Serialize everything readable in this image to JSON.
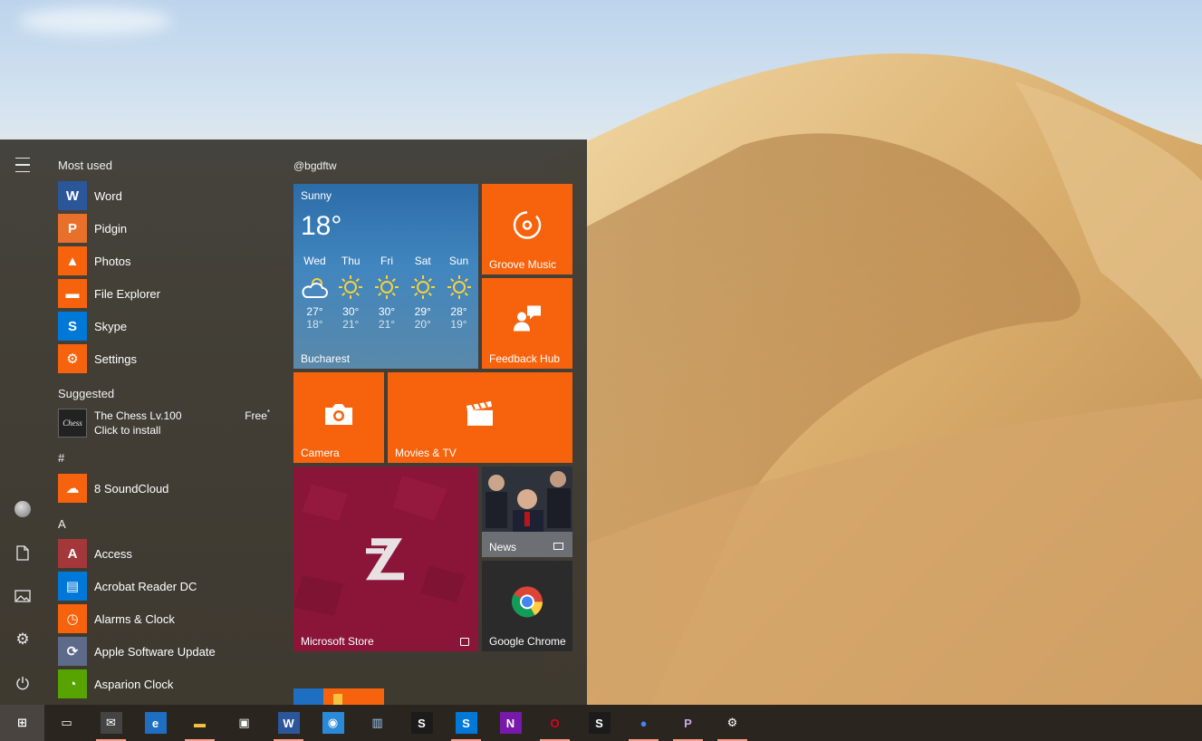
{
  "start_menu": {
    "most_used_heading": "Most used",
    "most_used": [
      {
        "label": "Word",
        "icon": "word-icon",
        "color": "#2b579a",
        "glyph": "W"
      },
      {
        "label": "Pidgin",
        "icon": "pidgin-icon",
        "color": "#e8702a",
        "glyph": "P"
      },
      {
        "label": "Photos",
        "icon": "photos-icon",
        "color": "#f7630c",
        "glyph": "▲"
      },
      {
        "label": "File Explorer",
        "icon": "file-explorer-icon",
        "color": "#f7630c",
        "glyph": "▬"
      },
      {
        "label": "Skype",
        "icon": "skype-icon",
        "color": "#0078d7",
        "glyph": "S"
      },
      {
        "label": "Settings",
        "icon": "gear-icon",
        "color": "#f7630c",
        "glyph": "⚙"
      }
    ],
    "suggested_heading": "Suggested",
    "suggested": {
      "name": "The Chess Lv.100",
      "action": "Click to install",
      "price": "Free",
      "icon_text": "Chess"
    },
    "hash_heading": "#",
    "hash_apps": [
      {
        "label": "8 SoundCloud",
        "icon": "soundcloud-icon",
        "color": "#f7630c",
        "glyph": "☁"
      }
    ],
    "a_heading": "A",
    "a_apps": [
      {
        "label": "Access",
        "icon": "access-icon",
        "color": "#a4373a",
        "glyph": "A"
      },
      {
        "label": "Acrobat Reader DC",
        "icon": "acrobat-icon",
        "color": "#0078d7",
        "glyph": "▤"
      },
      {
        "label": "Alarms & Clock",
        "icon": "alarm-clock-icon",
        "color": "#f7630c",
        "glyph": "◷"
      },
      {
        "label": "Apple Software Update",
        "icon": "apple-update-icon",
        "color": "#5e6a8a",
        "glyph": "⟳"
      },
      {
        "label": "Asparion Clock",
        "icon": "clock-icon",
        "color": "#57a300",
        "glyph": "◔"
      }
    ]
  },
  "tiles": {
    "group_title": "@bgdftw",
    "weather": {
      "condition": "Sunny",
      "temperature": "18°",
      "city": "Bucharest",
      "forecast": [
        {
          "day": "Wed",
          "hi": "27°",
          "lo": "18°",
          "icon": "partly-cloudy-icon"
        },
        {
          "day": "Thu",
          "hi": "30°",
          "lo": "21°",
          "icon": "sun-icon"
        },
        {
          "day": "Fri",
          "hi": "30°",
          "lo": "21°",
          "icon": "sun-icon"
        },
        {
          "day": "Sat",
          "hi": "29°",
          "lo": "20°",
          "icon": "sun-icon"
        },
        {
          "day": "Sun",
          "hi": "28°",
          "lo": "19°",
          "icon": "sun-icon"
        }
      ]
    },
    "groove_music": "Groove Music",
    "feedback_hub": "Feedback Hub",
    "camera": "Camera",
    "movies_tv": "Movies & TV",
    "microsoft_store": "Microsoft Store",
    "news": "News",
    "google_chrome": "Google Chrome",
    "accent": "#f7630c"
  },
  "taskbar": {
    "items": [
      {
        "name": "start-button",
        "glyph": "⊞",
        "color": "#ffffff",
        "bg": "transparent",
        "active": true,
        "running": false
      },
      {
        "name": "task-view-button",
        "glyph": "▭",
        "color": "#ffffff",
        "bg": "transparent",
        "active": false,
        "running": false
      },
      {
        "name": "mail-taskbar-icon",
        "glyph": "✉",
        "color": "#ffffff",
        "bg": "#444444",
        "active": false,
        "running": true
      },
      {
        "name": "edge-taskbar-icon",
        "glyph": "e",
        "color": "#ffffff",
        "bg": "#1e6fc2",
        "active": false,
        "running": false
      },
      {
        "name": "file-explorer-taskbar-icon",
        "glyph": "▬",
        "color": "#f5c242",
        "bg": "transparent",
        "active": false,
        "running": true
      },
      {
        "name": "store-taskbar-icon",
        "glyph": "▣",
        "color": "#ffffff",
        "bg": "transparent",
        "active": false,
        "running": false
      },
      {
        "name": "word-taskbar-icon",
        "glyph": "W",
        "color": "#ffffff",
        "bg": "#2b579a",
        "active": false,
        "running": true
      },
      {
        "name": "keepass-taskbar-icon",
        "glyph": "◉",
        "color": "#ffffff",
        "bg": "#2a8ad8",
        "active": false,
        "running": false
      },
      {
        "name": "remote-desktop-taskbar-icon",
        "glyph": "▥",
        "color": "#9ecbf0",
        "bg": "transparent",
        "active": false,
        "running": false
      },
      {
        "name": "app-s-taskbar-icon",
        "glyph": "S",
        "color": "#ffffff",
        "bg": "#1b1b1b",
        "active": false,
        "running": false
      },
      {
        "name": "skype-taskbar-icon",
        "glyph": "S",
        "color": "#ffffff",
        "bg": "#0078d7",
        "active": false,
        "running": true
      },
      {
        "name": "onenote-taskbar-icon",
        "glyph": "N",
        "color": "#ffffff",
        "bg": "#7719aa",
        "active": false,
        "running": false
      },
      {
        "name": "opera-taskbar-icon",
        "glyph": "O",
        "color": "#e3001b",
        "bg": "transparent",
        "active": false,
        "running": true
      },
      {
        "name": "app-s2-taskbar-icon",
        "glyph": "S",
        "color": "#ffffff",
        "bg": "#1b1b1b",
        "active": false,
        "running": false
      },
      {
        "name": "chrome-taskbar-icon",
        "glyph": "●",
        "color": "#4285f4",
        "bg": "transparent",
        "active": false,
        "running": true
      },
      {
        "name": "pidgin-taskbar-icon",
        "glyph": "P",
        "color": "#c9a7e8",
        "bg": "transparent",
        "active": false,
        "running": true
      },
      {
        "name": "settings-taskbar-icon",
        "glyph": "⚙",
        "color": "#ffffff",
        "bg": "transparent",
        "active": false,
        "running": true
      }
    ],
    "running_indicator_color": "#f7a28a"
  }
}
